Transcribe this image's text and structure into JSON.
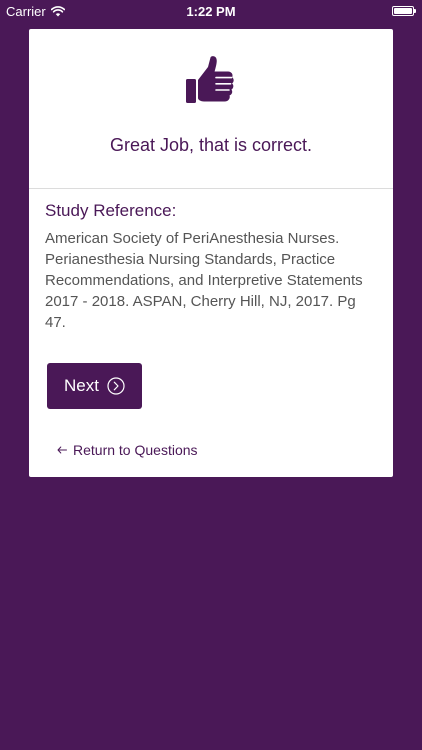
{
  "status_bar": {
    "carrier": "Carrier",
    "time": "1:22 PM"
  },
  "card": {
    "icon": "thumbs-up-icon",
    "success_message": "Great Job, that is correct.",
    "reference_heading": "Study Reference:",
    "reference_text": "American Society of PeriAnesthesia Nurses. Perianesthesia Nursing Standards, Practice Recommendations, and Interpretive Statements 2017 - 2018. ASPAN, Cherry Hill, NJ, 2017. Pg 47.",
    "next_label": "Next",
    "return_label": "Return to Questions"
  },
  "colors": {
    "brand": "#4a1857",
    "card_background": "#ffffff",
    "body_text": "#555555"
  }
}
